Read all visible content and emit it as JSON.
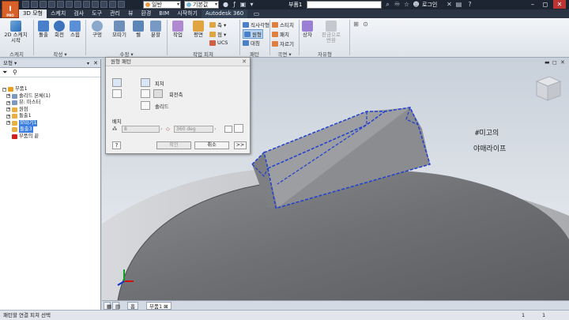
{
  "titlebar": {
    "logo_text": "I",
    "logo_sub": "PRO",
    "appearance_combo": "일반",
    "material_combo": "기본값",
    "document_title": "부품1",
    "login_label": "로그인",
    "icons": [
      "save-icon",
      "undo-icon",
      "redo-icon",
      "home-icon",
      "search-icon",
      "star-icon",
      "help-icon",
      "minimize-icon",
      "restore-icon",
      "close-icon"
    ]
  },
  "tabs": [
    "3D 모형",
    "스케치",
    "검사",
    "도구",
    "관리",
    "뷰",
    "환경",
    "BIM",
    "시작하기",
    "Autodesk 360"
  ],
  "ribbon": {
    "sketch_buttons": [
      {
        "label": "2D 스케치",
        "sub": "시작"
      }
    ],
    "create_buttons": [
      "돌출",
      "회전",
      "스윕",
      "구멍",
      "모따기",
      "쉘",
      "분할"
    ],
    "work_features": [
      "작업",
      "평면"
    ],
    "work_small": [
      "축 ▾",
      "점 ▾",
      "UCS"
    ],
    "pattern_small": [
      "직사각형",
      "원형",
      "대칭"
    ],
    "surface_small": [
      "스티치",
      "패치",
      "자르기"
    ],
    "freeform": [
      "상자"
    ],
    "convert": [
      "판금으로",
      "변환"
    ],
    "panels": {
      "sketch": "스케치",
      "create": "작성 ▾",
      "modify": "수정 ▾",
      "work": "작업 피쳐",
      "pattern": "패턴",
      "surface": "곡면 ▾",
      "freeform": "자유형"
    }
  },
  "browser": {
    "header": "모형 ▾",
    "items": [
      {
        "label": "부품1",
        "indent": 0,
        "expander": "−",
        "color": "#e8a020"
      },
      {
        "label": "솔리드 본체(1)",
        "indent": 1,
        "expander": "+",
        "color": "#7a9ac4"
      },
      {
        "label": "뷰: 마스터",
        "indent": 1,
        "expander": "+",
        "color": "#7a9ac4"
      },
      {
        "label": "원점",
        "indent": 1,
        "expander": "+",
        "color": "#e8b040"
      },
      {
        "label": "돌출1",
        "indent": 1,
        "expander": "+",
        "color": "#e8b040"
      },
      {
        "label": "모따기1",
        "indent": 1,
        "expander": "+",
        "color": "#e8b040",
        "highlighted": true
      },
      {
        "label": "돌출3",
        "indent": 1,
        "expander": "",
        "color": "#e8b040",
        "highlighted": true
      },
      {
        "label": "부품의 끝",
        "indent": 1,
        "expander": "",
        "color": "#d02020"
      }
    ]
  },
  "dialog": {
    "title": "원형 패턴",
    "opt_feature": "피쳐",
    "opt_rotation_axis": "회전축",
    "opt_solid": "솔리드",
    "placement": "배치",
    "count_value": "8",
    "angle_value": "360 deg",
    "ok": "확인",
    "cancel": "취소",
    "more": ">>"
  },
  "viewport": {
    "watermark_line1": "#미고의",
    "watermark_line2": "야매라이프"
  },
  "doctabs": [
    {
      "label": "홈"
    },
    {
      "label": "부품1"
    }
  ],
  "status": {
    "message": "패턴할 연결 피쳐 선택",
    "num1": "1",
    "num2": "1"
  }
}
